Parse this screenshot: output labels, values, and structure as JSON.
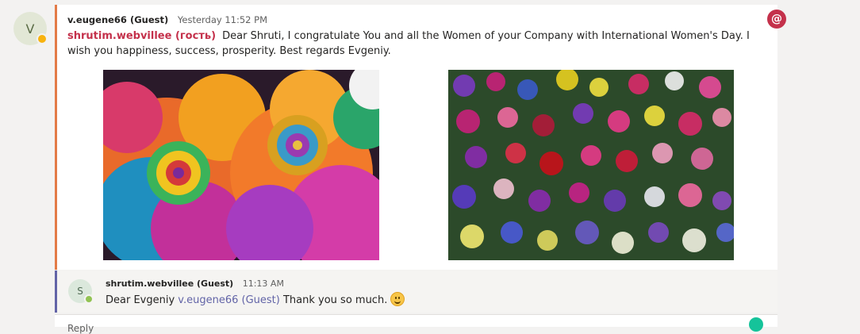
{
  "message": {
    "avatar_initial": "V",
    "author": "v.eugene66 (Guest)",
    "timestamp": "Yesterday 11:52 PM",
    "mention": "shrutim.webvillee (гость)",
    "text": "Dear Shruti, I congratulate You and all the Women of your Company with International Women's Day. I wish you happiness, success, prosperity. Best regards Evgeniy.",
    "mention_badge": "@"
  },
  "reply": {
    "avatar_initial": "S",
    "author": "shrutim.webvillee (Guest)",
    "timestamp": "11:13 AM",
    "text_before": "Dear Evgeniy",
    "mention": "v.eugene66 (Guest)",
    "text_after": "Thank you so much."
  },
  "compose": {
    "label": "Reply"
  },
  "colors": {
    "accent_orange": "#e37b47",
    "accent_purple": "#6264a7",
    "mention_red": "#c4314b"
  }
}
